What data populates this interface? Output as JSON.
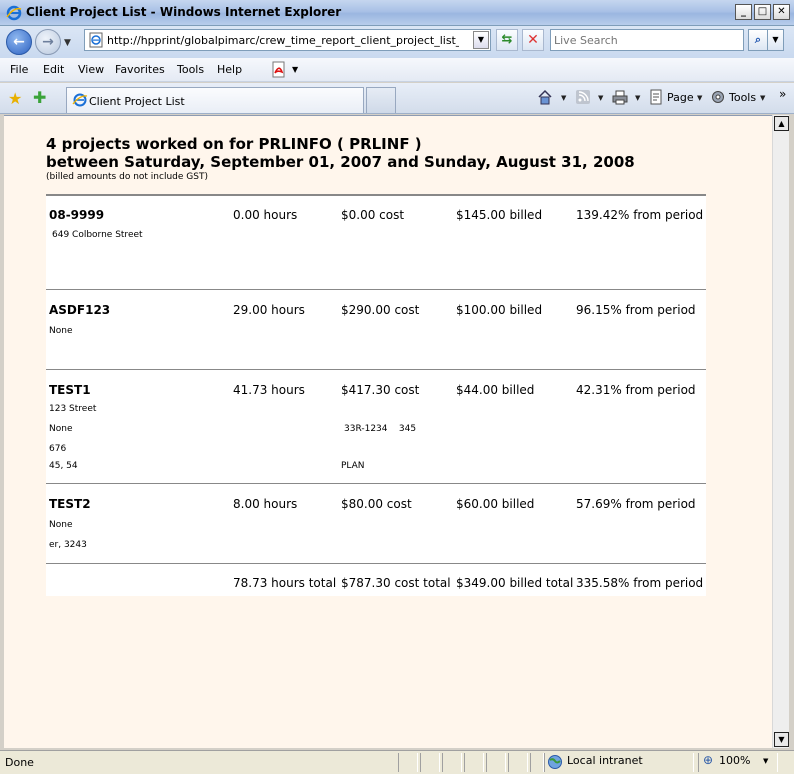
{
  "window": {
    "title": "Client Project List - Windows Internet Explorer"
  },
  "address": {
    "url": "http://hpprint/globalpimarc/crew_time_report_client_project_list_compile.asp",
    "search_placeholder": "Live Search"
  },
  "menu": {
    "file": "File",
    "edit": "Edit",
    "view": "View",
    "favorites": "Favorites",
    "tools": "Tools",
    "help": "Help"
  },
  "tab": {
    "label": "Client Project List"
  },
  "commands": {
    "page": "Page",
    "tools": "Tools"
  },
  "report": {
    "heading_line1": "4 projects worked on for PRLINFO ( PRLINF )",
    "heading_line2": "between Saturday, September 01, 2007 and Sunday, August 31, 2008",
    "note": "(billed amounts do not include GST)",
    "projects": [
      {
        "name": "08-9999",
        "hours": "0.00 hours",
        "cost": "$0.00 cost",
        "billed": "$145.00 billed",
        "percent": "139.42% from period",
        "details": [
          "649 Colborne Street"
        ]
      },
      {
        "name": "ASDF123",
        "hours": "29.00 hours",
        "cost": "$290.00 cost",
        "billed": "$100.00 billed",
        "percent": "96.15% from period",
        "details": [
          "None"
        ]
      },
      {
        "name": "TEST1",
        "hours": "41.73 hours",
        "cost": "$417.30 cost",
        "billed": "$44.00 billed",
        "percent": "42.31% from period",
        "details": [
          "123 Street",
          "None",
          "676",
          "45, 54"
        ],
        "extra": [
          "33R-1234    345",
          "PLAN"
        ]
      },
      {
        "name": "TEST2",
        "hours": "8.00 hours",
        "cost": "$80.00 cost",
        "billed": "$60.00 billed",
        "percent": "57.69% from period",
        "details": [
          "None",
          "er, 3243"
        ]
      }
    ],
    "totals": {
      "hours": "78.73 hours total",
      "cost": "$787.30 cost total",
      "billed": "$349.00 billed total",
      "percent": "335.58% from period"
    }
  },
  "status": {
    "text": "Done",
    "zone": "Local intranet",
    "zoom": "100%"
  }
}
